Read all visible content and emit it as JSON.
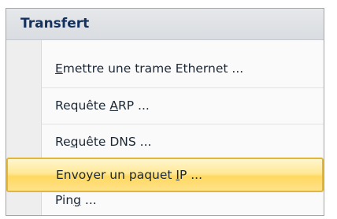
{
  "menu": {
    "title": "Transfert",
    "items": [
      {
        "label": "Emettre une trame Ethernet ...",
        "mnemonic_char": "E"
      },
      {
        "label": "Requête ARP ...",
        "mnemonic_char": "A"
      },
      {
        "label": "Requête DNS ...",
        "mnemonic_char": "q"
      },
      {
        "label": "Envoyer un paquet IP ...",
        "mnemonic_char": "I",
        "highlighted": true
      },
      {
        "label": "Ping ...",
        "mnemonic_char": "g"
      }
    ]
  }
}
